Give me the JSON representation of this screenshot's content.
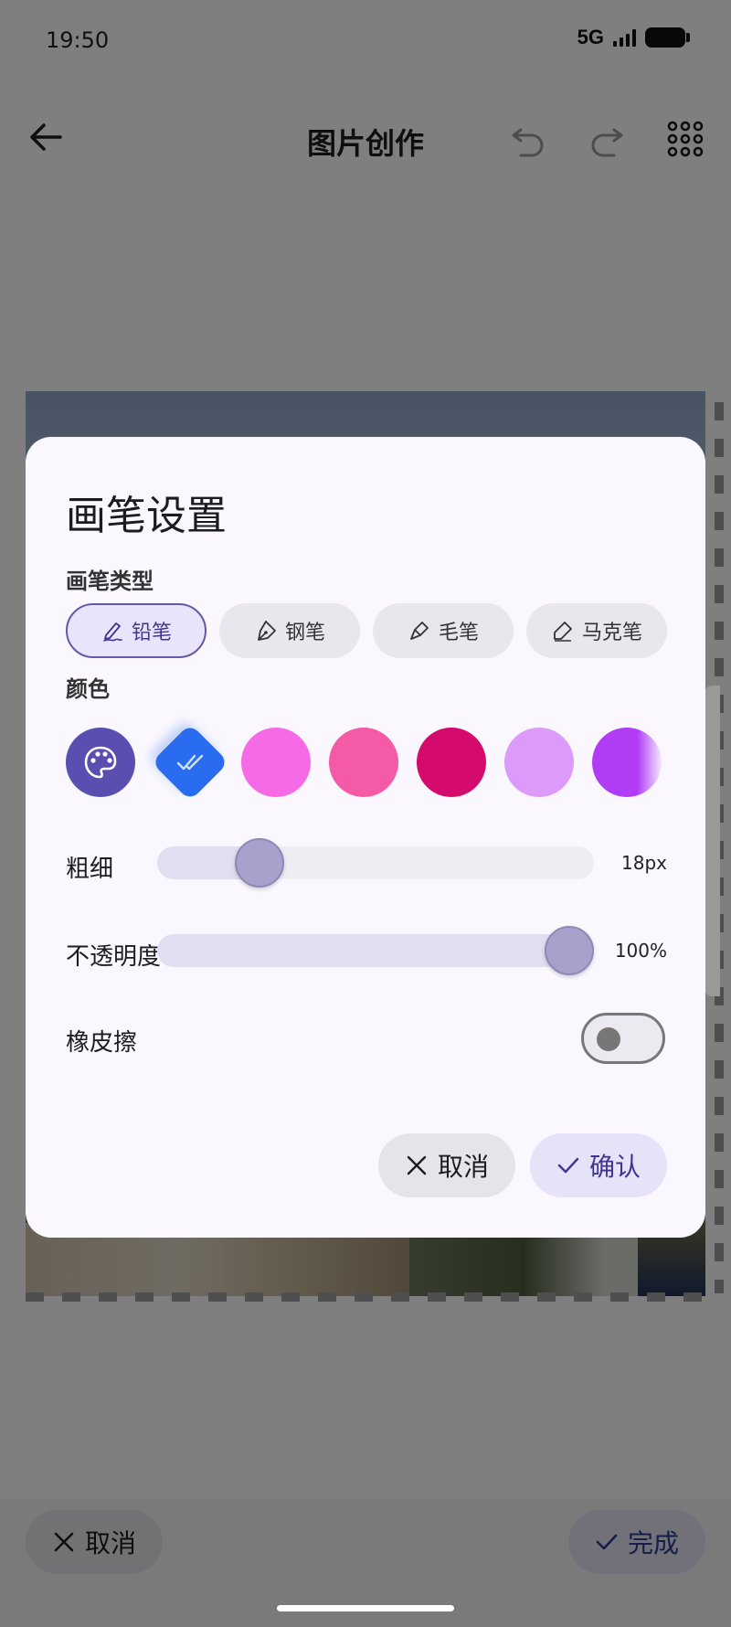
{
  "status_bar": {
    "time": "19:50",
    "network": "5G"
  },
  "header": {
    "title": "图片创作",
    "icons": [
      "back-arrow-icon",
      "undo-icon",
      "redo-icon",
      "grid-menu-icon"
    ]
  },
  "bottom_bar": {
    "cancel_label": "取消",
    "done_label": "完成"
  },
  "dialog": {
    "title": "画笔设置",
    "brush_type_label": "画笔类型",
    "brush_types": [
      {
        "label": "铅笔",
        "icon": "pencil-icon",
        "selected": true
      },
      {
        "label": "钢笔",
        "icon": "fountain-pen-icon",
        "selected": false
      },
      {
        "label": "毛笔",
        "icon": "brush-icon",
        "selected": false
      },
      {
        "label": "马克笔",
        "icon": "marker-icon",
        "selected": false
      }
    ],
    "color_label": "颜色",
    "colors": [
      {
        "name": "palette",
        "hex": "#5a4fb0",
        "icon": "palette-icon"
      },
      {
        "name": "selected-blue",
        "hex": "#2a6cf0",
        "selected": true,
        "icon": "double-check-icon"
      },
      {
        "name": "pink-light",
        "hex": "#f76ae6"
      },
      {
        "name": "pink",
        "hex": "#f45aa6"
      },
      {
        "name": "crimson",
        "hex": "#d40a6c"
      },
      {
        "name": "lilac",
        "hex": "#dc9afa"
      },
      {
        "name": "purple",
        "hex": "#b13cf6"
      }
    ],
    "thickness": {
      "label": "粗细",
      "value_text": "18px",
      "fraction": 0.2
    },
    "opacity": {
      "label": "不透明度",
      "value_text": "100%",
      "fraction": 1.0
    },
    "eraser": {
      "label": "橡皮擦",
      "on": false
    },
    "cancel_label": "取消",
    "confirm_label": "确认"
  }
}
